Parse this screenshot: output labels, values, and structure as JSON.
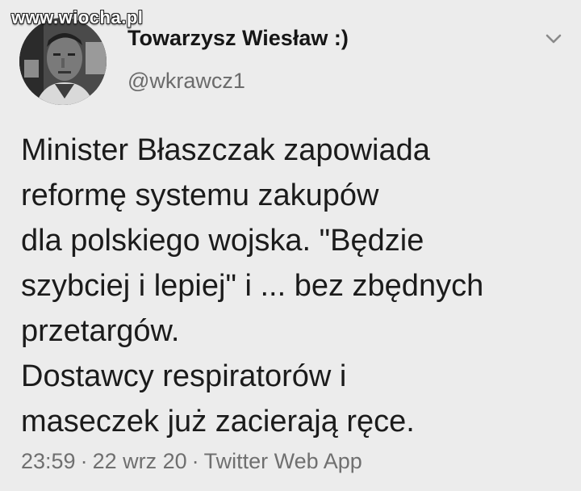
{
  "watermark": "www.wiocha.pl",
  "author": {
    "display_name": "Towarzysz Wiesław :)",
    "handle": "@wkrawcz1"
  },
  "menu_icon": "chevron-down-icon",
  "tweet": {
    "lines": [
      "Minister Błaszczak zapowiada",
      "reformę systemu zakupów",
      "dla polskiego wojska. \"Będzie",
      "szybciej i lepiej\" i ... bez zbędnych",
      "przetargów.",
      "Dostawcy respiratorów i",
      "maseczek już zacierają ręce."
    ]
  },
  "meta": {
    "time": "23:59",
    "date": "22 wrz 20",
    "source": "Twitter Web App",
    "separator": "·"
  },
  "colors": {
    "background": "#ececec",
    "text": "#1b1b1b",
    "secondary": "#6f6f6f"
  }
}
